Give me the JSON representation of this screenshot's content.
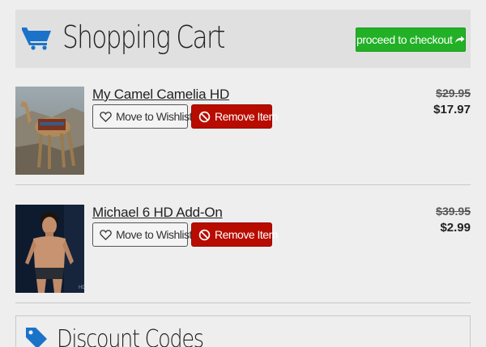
{
  "header": {
    "title": "Shopping Cart",
    "checkout_label": "proceed to checkout",
    "icon": "shopping-cart-icon"
  },
  "items": [
    {
      "title": "My Camel Camelia HD",
      "wishlist_label": "Move to Wishlist",
      "remove_label": "Remove Item",
      "price_original": "$29.95",
      "price_sale": "$17.97",
      "thumbnail": "camel-render-thumbnail"
    },
    {
      "title": "Michael 6 HD Add-On",
      "wishlist_label": "Move to Wishlist",
      "remove_label": "Remove Item",
      "price_original": "$39.95",
      "price_sale": "$2.99",
      "thumbnail": "male-figure-render-thumbnail"
    }
  ],
  "discount": {
    "title": "Discount Codes",
    "icon": "tag-icon"
  },
  "colors": {
    "accent": "#1a73c9",
    "checkout": "#22b026",
    "remove": "#b80c00",
    "background": "#eeeeee"
  }
}
